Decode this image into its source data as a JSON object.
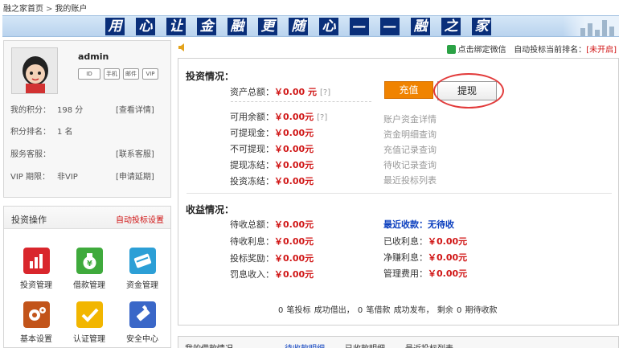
{
  "breadcrumb": {
    "home": "融之家首页",
    "separator": ">",
    "current": "我的账户"
  },
  "banner": {
    "chars": [
      "用",
      "心",
      "让",
      "金",
      "融",
      "更",
      "随",
      "心",
      "—",
      "—",
      "融",
      "之",
      "家"
    ]
  },
  "profile": {
    "username": "admin",
    "badges": [
      "ID",
      "手机",
      "邮件",
      "VIP"
    ],
    "points_label": "我的积分：",
    "points_value": "198 分",
    "points_link": "[查看详情]",
    "rank_label": "积分排名：",
    "rank_value": "1 名",
    "service_label": "服务客服：",
    "service_link": "[联系客服]",
    "vip_label": "VIP 期限：",
    "vip_value": "非VIP",
    "vip_link": "[申请延期]"
  },
  "ops": {
    "title": "投资操作",
    "auto_link": "自动投标设置",
    "items": [
      {
        "label": "投资管理",
        "color": "#d9262c"
      },
      {
        "label": "借款管理",
        "color": "#3faa3c"
      },
      {
        "label": "资金管理",
        "color": "#2c9fd6"
      },
      {
        "label": "基本设置",
        "color": "#c2541a"
      },
      {
        "label": "认证管理",
        "color": "#f2b600"
      },
      {
        "label": "安全中心",
        "color": "#3a67c8"
      }
    ]
  },
  "topbar": {
    "wechat": "点击绑定微信",
    "rank_label": "自动投标当前排名：",
    "rank_value": "[未开启]"
  },
  "investment": {
    "title": "投资情况：",
    "total_label": "资产总额：",
    "total_value": "￥0.00 元",
    "help": "[?]",
    "recharge": "充值",
    "withdraw": "提现",
    "rows": [
      {
        "label": "可用余额：",
        "value": "￥0.00元",
        "help": "[?]"
      },
      {
        "label": "可提现金：",
        "value": "￥0.00元"
      },
      {
        "label": "不可提现：",
        "value": "￥0.00元"
      },
      {
        "label": "提现冻结：",
        "value": "￥0.00元"
      },
      {
        "label": "投资冻结：",
        "value": "￥0.00元"
      }
    ],
    "links": [
      "账户资金详情",
      "资金明细查询",
      "充值记录查询",
      "待收记录查询",
      "最近投标列表"
    ]
  },
  "income": {
    "title": "收益情况：",
    "rows": [
      {
        "label": "待收总额：",
        "value": "￥0.00元"
      },
      {
        "label": "待收利息：",
        "value": "￥0.00元"
      },
      {
        "label": "投标奖励：",
        "value": "￥0.00元"
      },
      {
        "label": "罚息收入：",
        "value": "￥0.00元"
      }
    ],
    "recent": "最近收款：无待收",
    "right_rows": [
      {
        "label": "已收利息：",
        "value": "￥0.00元"
      },
      {
        "label": "净赚利息：",
        "value": "￥0.00元"
      },
      {
        "label": "管理费用：",
        "value": "￥0.00元"
      }
    ]
  },
  "summary": "0 笔投标 成功借出， 0 笔借款 成功发布， 剩余 0 期待收款",
  "bottom": {
    "title": "我的借款情况",
    "tab1": "待收款明细",
    "tab2": "已收款明细",
    "tab3": "最近投标列表"
  }
}
